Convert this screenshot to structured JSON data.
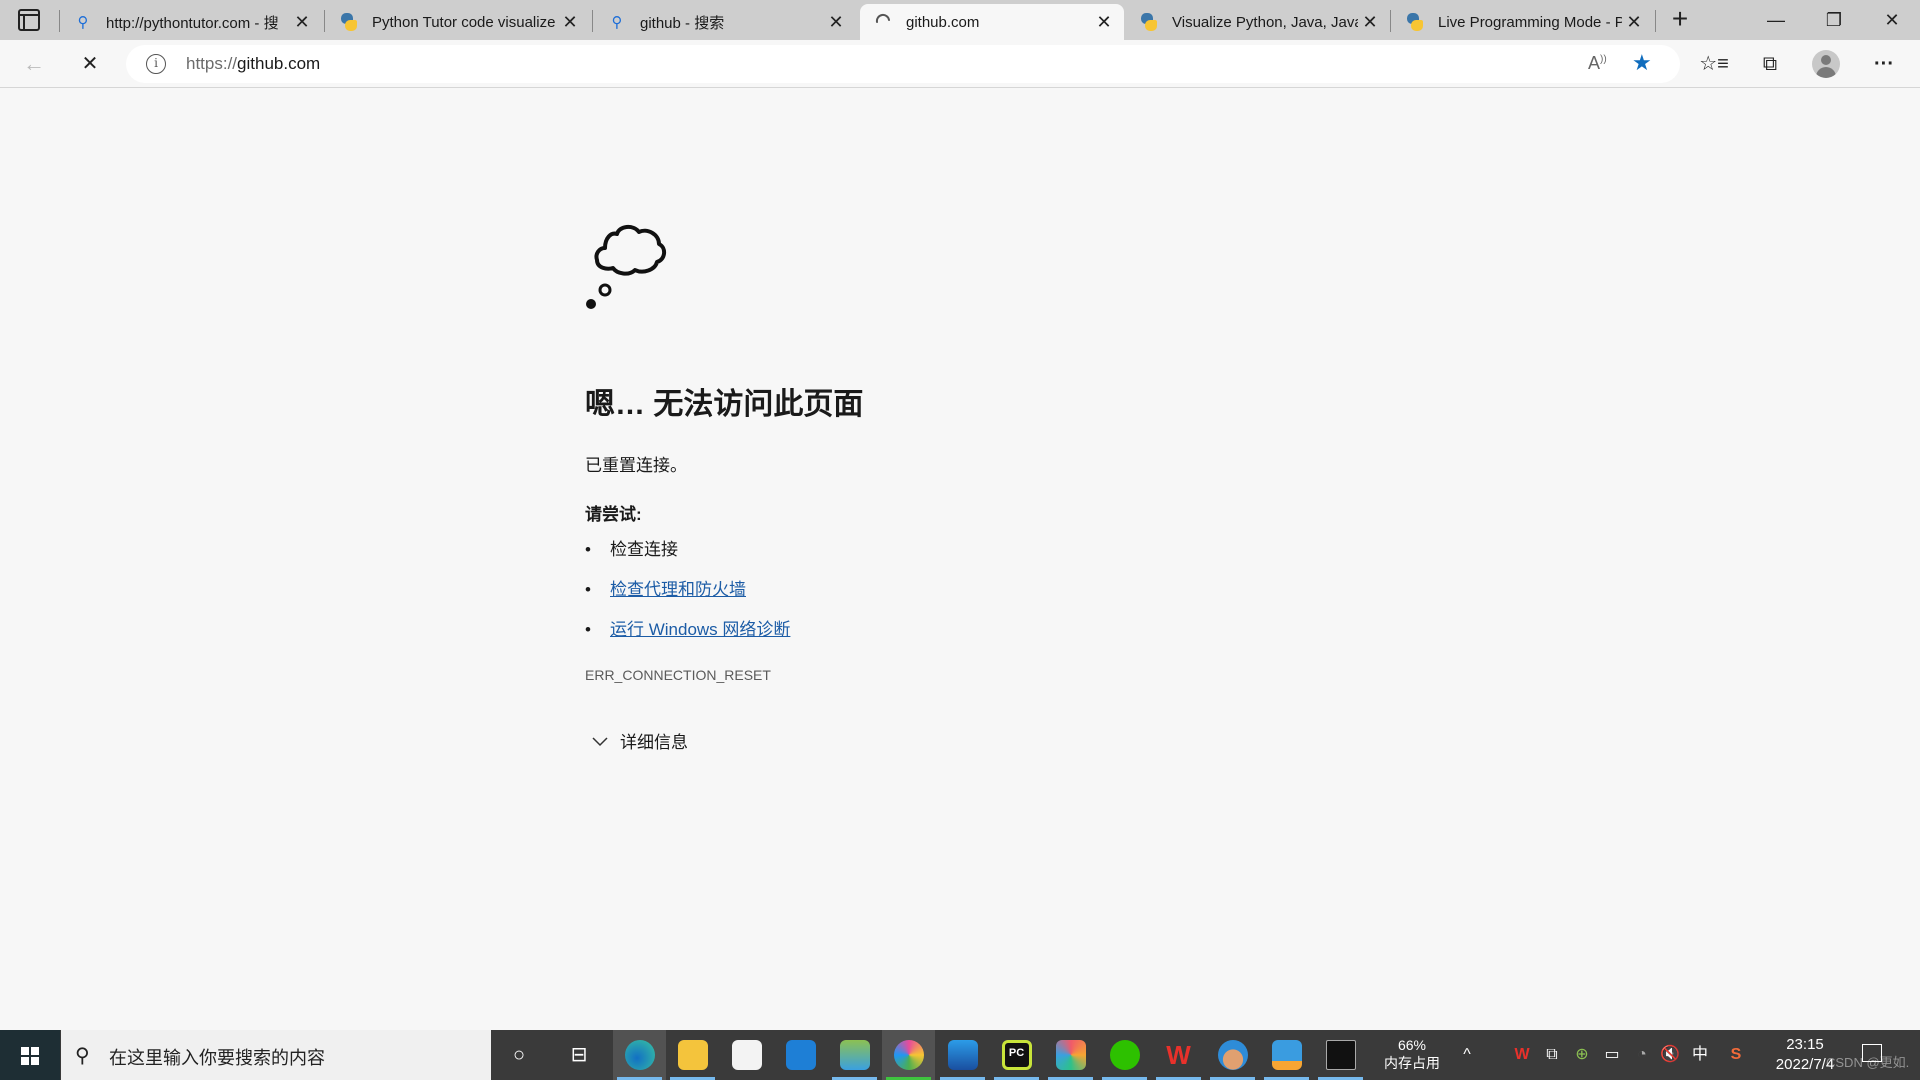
{
  "browser": {
    "tabs": [
      {
        "title": "http://pythontutor.com - 搜",
        "icon": "search-icon",
        "active": false
      },
      {
        "title": "Python Tutor code visualize",
        "icon": "python-icon",
        "active": false
      },
      {
        "title": "github - 搜索",
        "icon": "search-icon",
        "active": false
      },
      {
        "title": "github.com",
        "icon": "loading-spinner-icon",
        "active": true
      },
      {
        "title": "Visualize Python, Java, JavaS",
        "icon": "python-icon",
        "active": false
      },
      {
        "title": "Live Programming Mode - P",
        "icon": "python-icon",
        "active": false
      }
    ],
    "tab_close_glyph": "✕",
    "new_tab_glyph": "+",
    "window_controls": {
      "minimize": "—",
      "restore": "❐",
      "close": "✕"
    },
    "address": {
      "scheme": "https://",
      "host": "github.com"
    },
    "read_aloud_glyph": "A᠀",
    "toolbar_glyphs": {
      "back": "←",
      "stop": "✕",
      "favorite": "★",
      "favorites": "☆≡",
      "collections": "⧉",
      "more": "···"
    },
    "info_glyph": "i"
  },
  "page": {
    "heading": "嗯… 无法访问此页面",
    "description": "已重置连接。",
    "try_label": "请尝试:",
    "suggestions": [
      {
        "text": "检查连接",
        "link": false
      },
      {
        "text": "检查代理和防火墙",
        "link": true
      },
      {
        "text": "运行 Windows 网络诊断",
        "link": true
      }
    ],
    "error_code": "ERR_CONNECTION_RESET",
    "details_label": "详细信息",
    "link_color": "#1c5ca6"
  },
  "taskbar": {
    "search_placeholder": "在这里输入你要搜索的内容",
    "apps": [
      {
        "name": "edge",
        "color": "#1f8fe0",
        "active": true
      },
      {
        "name": "file-explorer",
        "color": "#f4c43c",
        "active": false
      },
      {
        "name": "microsoft-store",
        "color": "#f3f3f3",
        "active": false
      },
      {
        "name": "mail",
        "color": "#1e7fd6",
        "active": false
      },
      {
        "name": "app-green-arrow",
        "color": "#6fbf4a",
        "active": false
      },
      {
        "name": "colorful-app",
        "color": "#e84b9a",
        "active": true
      },
      {
        "name": "photos",
        "color": "#2c8ce0",
        "active": false
      },
      {
        "name": "pycharm",
        "color": "#21d789",
        "active": false
      },
      {
        "name": "flower-app",
        "color": "#f05a6a",
        "active": false
      },
      {
        "name": "wechat",
        "color": "#2dc100",
        "active": false
      },
      {
        "name": "wps-office",
        "color": "#e8312b",
        "active": false
      },
      {
        "name": "character-app",
        "color": "#2e8cd8",
        "active": false
      },
      {
        "name": "archive-app",
        "color": "#3a9ce0",
        "active": false
      },
      {
        "name": "terminal",
        "color": "#111111",
        "active": false
      }
    ],
    "memory_percent": "66%",
    "memory_label": "内存占用",
    "tray_up_glyph": "^",
    "ime_label": "中",
    "time": "23:15",
    "date": "2022/7/4",
    "watermark": "CSDN @更如."
  }
}
